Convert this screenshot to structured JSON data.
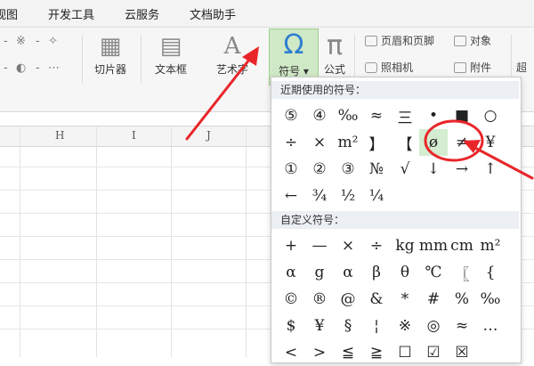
{
  "menu": {
    "tabs": [
      "视图",
      "开发工具",
      "云服务",
      "文档助手"
    ]
  },
  "ribbon": {
    "left_glyphs_row1": [
      "-",
      "※",
      "-",
      "✧"
    ],
    "left_glyphs_row2": [
      "-",
      "◐",
      "-",
      "⋯"
    ],
    "slicer_label": "切片器",
    "textbox_label": "文本框",
    "wordart_label": "艺术字",
    "symbol_label": "符号",
    "symbol_icon": "Ω",
    "formula_label": "公式",
    "formula_icon": "π",
    "header_footer_label": "页眉和页脚",
    "object_label": "对象",
    "camera_label": "照相机",
    "attachment_label": "附件",
    "partial_label": "超"
  },
  "sheet": {
    "columns": [
      "H",
      "I",
      "J"
    ]
  },
  "symbol_panel": {
    "recent_title": "近期使用的符号：",
    "recent_symbols": [
      "⑤",
      "④",
      "‰",
      "≈",
      "三",
      "•",
      "■",
      "○",
      "÷",
      "×",
      "m²",
      "】",
      "【",
      "ø",
      "≠",
      "¥",
      "①",
      "②",
      "③",
      "№",
      "√",
      "↓",
      "→",
      "↑",
      "←",
      "¾",
      "½",
      "¼"
    ],
    "highlighted_symbol": "ø",
    "custom_title": "自定义符号：",
    "custom_symbols": [
      "+",
      "—",
      "×",
      "÷",
      "kg",
      "mm",
      "cm",
      "m²",
      "α",
      "g",
      "α",
      "β",
      "θ",
      "℃",
      "〖",
      "{",
      "©",
      "®",
      "@",
      "&",
      "*",
      "#",
      "%",
      "‰",
      "$",
      "¥",
      "§",
      "¦",
      "※",
      "◎",
      "≈",
      "…",
      "<",
      ">",
      "≦",
      "≧",
      "☐",
      "☑",
      "☒",
      ""
    ]
  },
  "colors": {
    "accent_green": "#cfe8c6",
    "annotation_red": "#e8262a",
    "symbol_icon_blue": "#2f7fd0"
  }
}
